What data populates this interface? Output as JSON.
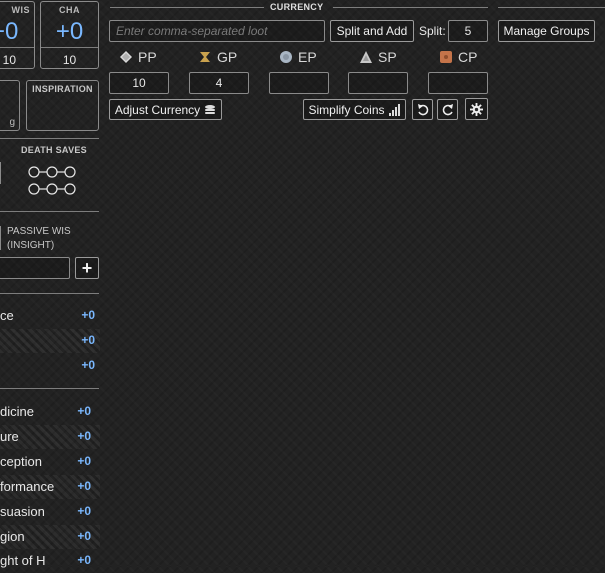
{
  "abilities": [
    {
      "abbr": "WIS",
      "mod": "+0",
      "score": "10"
    },
    {
      "abbr": "CHA",
      "mod": "+0",
      "score": "10"
    }
  ],
  "inspiration_label": "INSPIRATION",
  "left_box_partial": "g",
  "death_saves_label": "DEATH SAVES",
  "passive_label_line1": "PASSIVE WIS",
  "passive_label_line2": "(INSIGHT)",
  "add_symbol": "+",
  "skills_group1": [
    {
      "label": "ce",
      "value": "+0"
    },
    {
      "label": "",
      "value": "+0"
    },
    {
      "label": "",
      "value": "+0"
    }
  ],
  "skills_group2": [
    {
      "label": "dicine",
      "value": "+0"
    },
    {
      "label": "ure",
      "value": "+0"
    },
    {
      "label": "ception",
      "value": "+0"
    },
    {
      "label": "formance",
      "value": "+0"
    },
    {
      "label": "suasion",
      "value": "+0"
    },
    {
      "label": "gion",
      "value": "+0"
    },
    {
      "label": "ght of H",
      "value": "+0"
    }
  ],
  "currency": {
    "title": "CURRENCY",
    "loot_placeholder": "Enter comma-separated loot",
    "split_add_label": "Split and Add",
    "split_label": "Split:",
    "split_value": "5",
    "coins": [
      {
        "name": "PP",
        "value": "10",
        "icon": "platinum-coin-icon",
        "color": "#d9d9d9"
      },
      {
        "name": "GP",
        "value": "4",
        "icon": "gold-coin-icon",
        "color": "#c9a24e"
      },
      {
        "name": "EP",
        "value": "",
        "icon": "electrum-coin-icon",
        "color": "#a9b6c4"
      },
      {
        "name": "SP",
        "value": "",
        "icon": "silver-coin-icon",
        "color": "#c8c8c8"
      },
      {
        "name": "CP",
        "value": "",
        "icon": "copper-coin-icon",
        "color": "#c4744a"
      }
    ],
    "adjust_label": "Adjust Currency",
    "simplify_label": "Simplify Coins"
  },
  "manage_groups_label": "Manage Groups"
}
